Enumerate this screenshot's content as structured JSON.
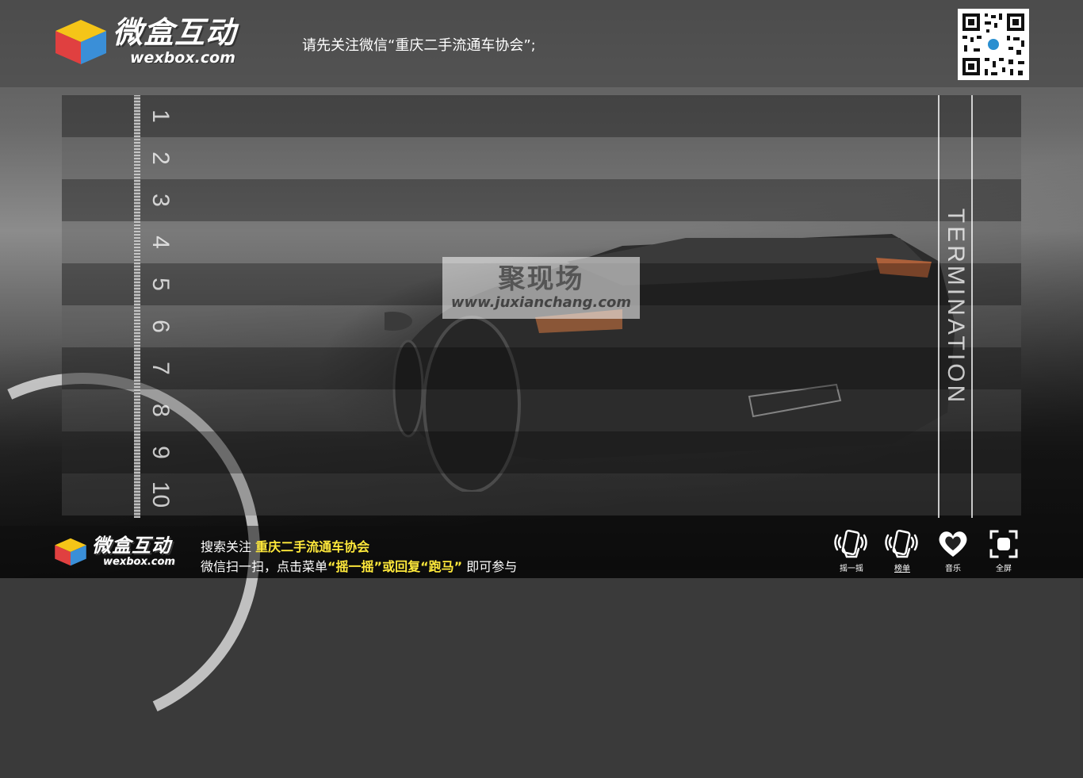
{
  "header": {
    "brand_cn": "微盒互动",
    "brand_en": "wexbox.com",
    "notice": "请先关注微信“重庆二手流通车协会”;"
  },
  "track": {
    "lanes": [
      "1",
      "2",
      "3",
      "4",
      "5",
      "6",
      "7",
      "8",
      "9",
      "10"
    ],
    "finish_label": "TERMINATION"
  },
  "watermark": {
    "title": "聚现场",
    "url": "www.juxianchang.com"
  },
  "footer": {
    "brand_cn": "微盒互动",
    "brand_en": "wexbox.com",
    "line1_prefix": "搜索关注 ",
    "line1_account": "重庆二手流通车协会",
    "line2_prefix": "微信扫一扫，点击菜单",
    "line2_shake": "“摇一摇”",
    "line2_or": "或回复",
    "line2_race": "“跑马”",
    "line2_suffix": " 即可参与"
  },
  "controls": [
    {
      "icon": "shake-phone-icon",
      "label": "摇一摇"
    },
    {
      "icon": "ranking-phone-icon",
      "label": "榜单"
    },
    {
      "icon": "heart-music-icon",
      "label": "音乐"
    },
    {
      "icon": "fullscreen-icon",
      "label": "全屏"
    }
  ],
  "colors": {
    "highlight": "#ffe93b",
    "cube_top": "#f5c518",
    "cube_left": "#e04040",
    "cube_right": "#3a8fd8"
  }
}
